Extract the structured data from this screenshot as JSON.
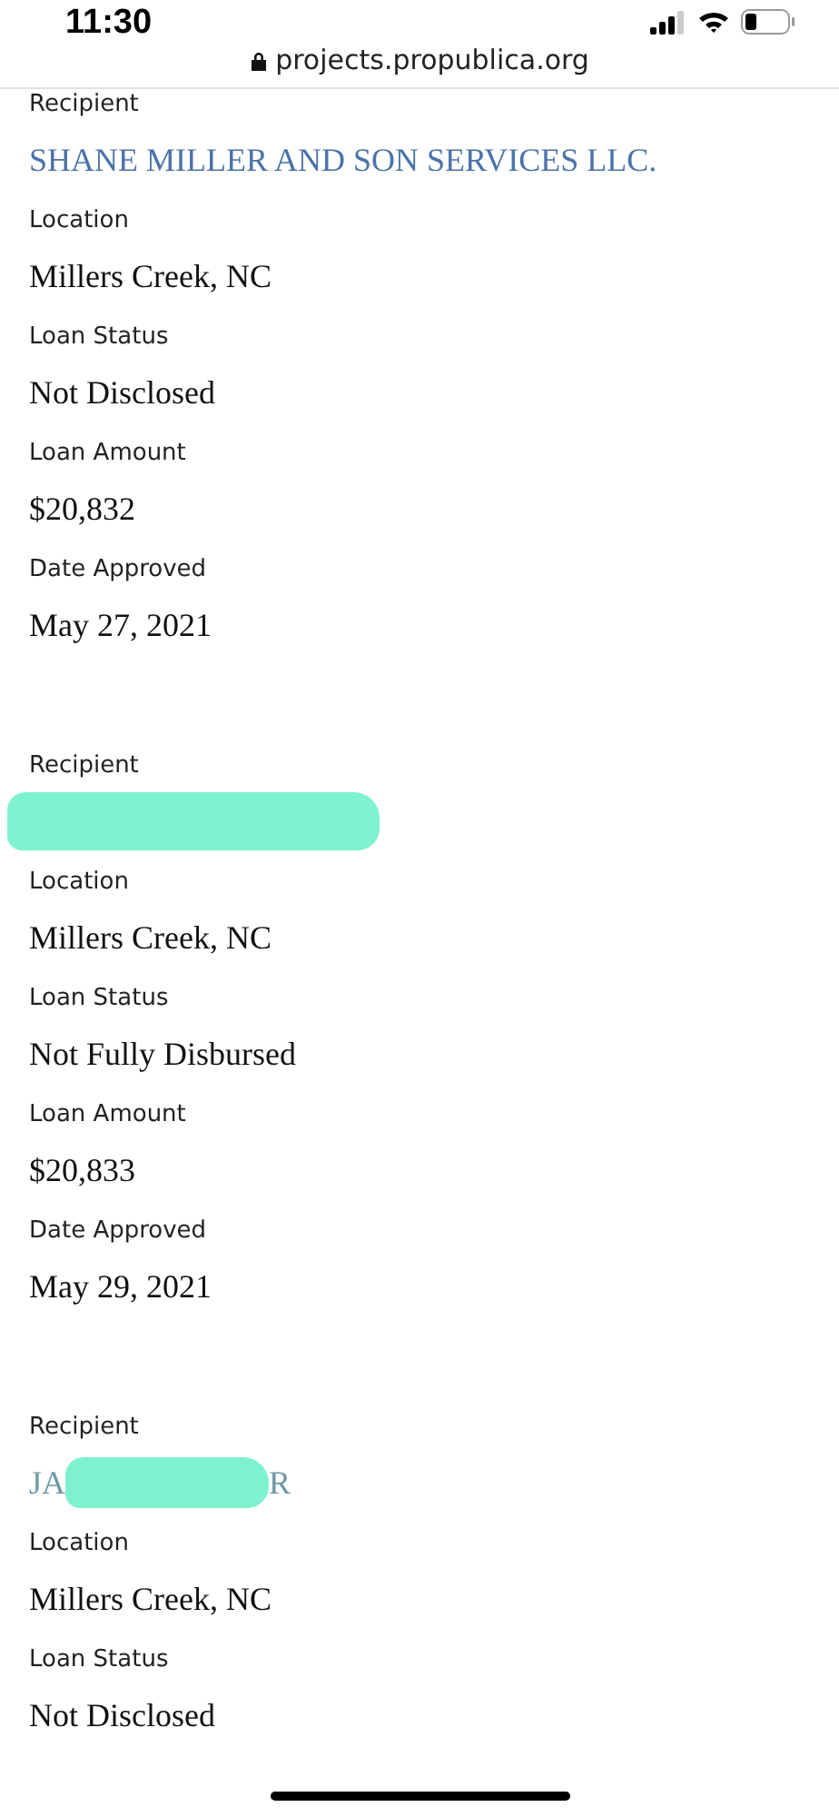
{
  "status_bar": {
    "time": "11:30"
  },
  "address_bar": {
    "url": "projects.propublica.org"
  },
  "records": [
    {
      "fields": [
        {
          "kind": "name",
          "label": "Recipient",
          "parts": [
            {
              "kind": "text",
              "text": "SHANE MILLER AND SON SERVICES LLC."
            }
          ]
        },
        {
          "kind": "value",
          "label": "Location",
          "value": "Millers Creek, NC"
        },
        {
          "kind": "value",
          "label": "Loan Status",
          "value": "Not Disclosed"
        },
        {
          "kind": "value",
          "label": "Loan Amount",
          "value": "$20,832"
        },
        {
          "kind": "value",
          "label": "Date Approved",
          "value": "May 27, 2021"
        }
      ]
    },
    {
      "fields": [
        {
          "kind": "name",
          "label": "Recipient",
          "parts": [
            {
              "kind": "redaction"
            }
          ]
        },
        {
          "kind": "value",
          "label": "Location",
          "value": "Millers Creek, NC"
        },
        {
          "kind": "value",
          "label": "Loan Status",
          "value": "Not Fully Disbursed"
        },
        {
          "kind": "value",
          "label": "Loan Amount",
          "value": "$20,833"
        },
        {
          "kind": "value",
          "label": "Date Approved",
          "value": "May 29, 2021"
        }
      ]
    },
    {
      "fields": [
        {
          "kind": "name",
          "label": "Recipient",
          "parts": [
            {
              "kind": "text",
              "text": "JA"
            },
            {
              "kind": "redaction"
            },
            {
              "kind": "text",
              "text": "R"
            }
          ]
        },
        {
          "kind": "value",
          "label": "Location",
          "value": "Millers Creek, NC"
        },
        {
          "kind": "value",
          "label": "Loan Status",
          "value": "Not Disclosed"
        }
      ]
    }
  ]
}
